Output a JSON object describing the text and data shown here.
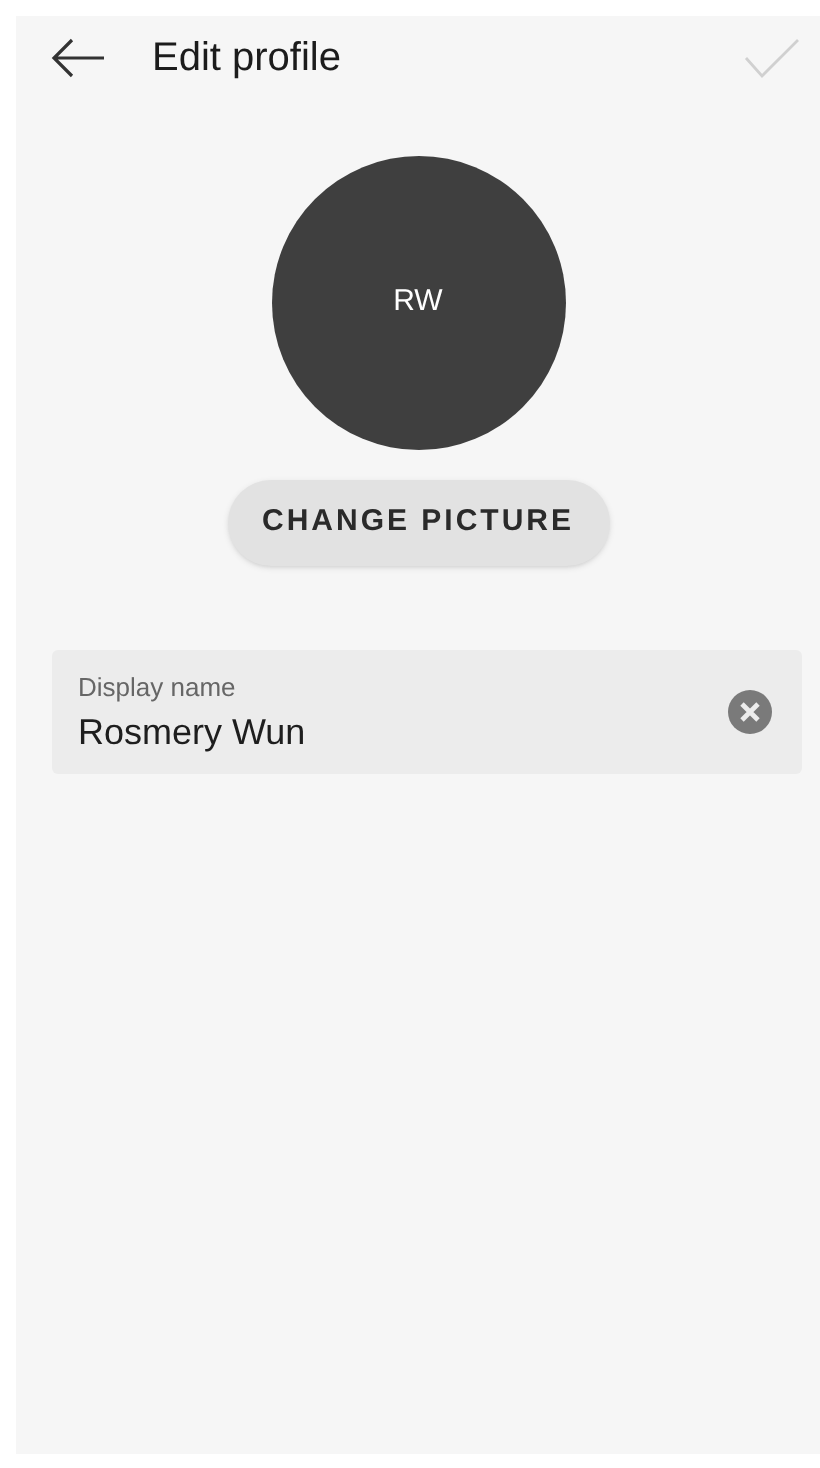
{
  "header": {
    "title": "Edit profile",
    "save_disabled": true
  },
  "avatar": {
    "initials": "RW"
  },
  "change_picture_button": "CHANGE PICTURE",
  "display_name_field": {
    "label": "Display name",
    "value": "Rosmery Wun"
  }
}
